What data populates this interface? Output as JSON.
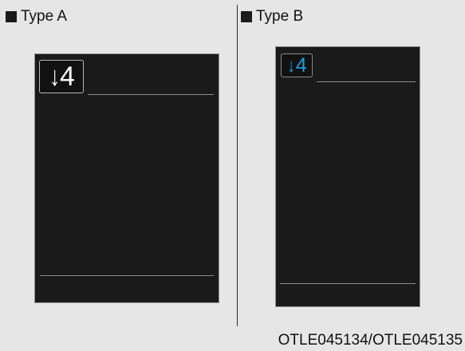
{
  "panels": [
    {
      "label": "Type A",
      "gear": {
        "arrow": "↓",
        "value": "4",
        "color": "#ffffff"
      }
    },
    {
      "label": "Type B",
      "gear": {
        "arrow": "↓",
        "value": "4",
        "color": "#1aa0de"
      }
    }
  ],
  "image_code": "OTLE045134/OTLE045135",
  "icons": {
    "heading_marker": "square-bullet-icon",
    "gear_arrow": "down-arrow-icon"
  }
}
